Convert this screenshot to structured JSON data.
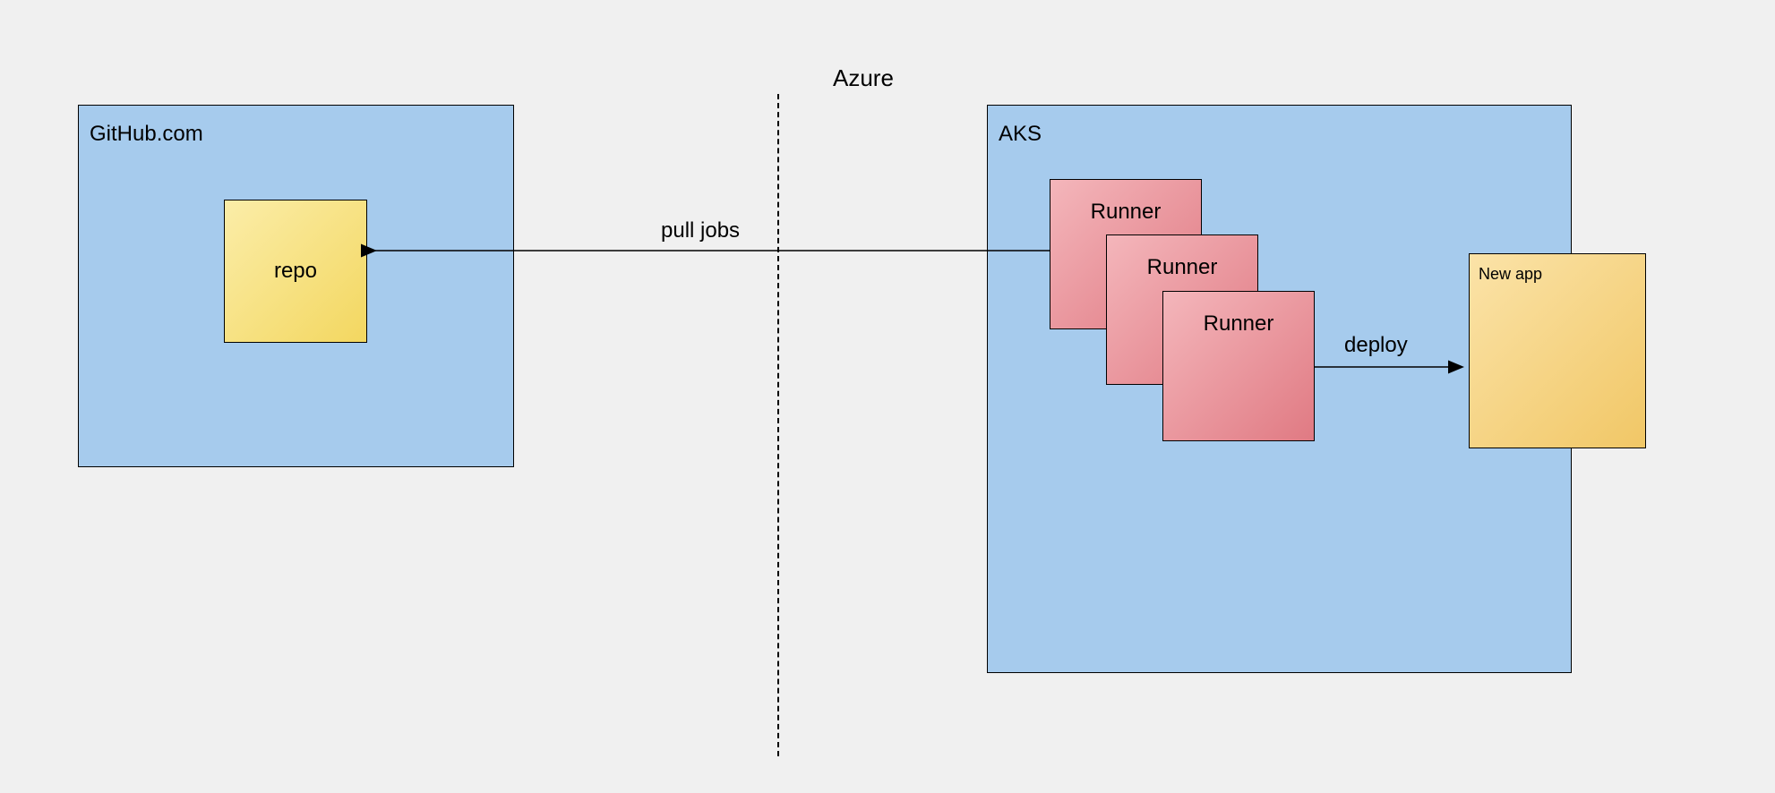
{
  "diagram": {
    "azure_label": "Azure",
    "github": {
      "title": "GitHub.com",
      "repo_label": "repo"
    },
    "aks": {
      "title": "AKS",
      "runners": [
        "Runner",
        "Runner",
        "Runner"
      ],
      "new_app_label": "New app"
    },
    "arrows": {
      "pull_jobs_label": "pull jobs",
      "deploy_label": "deploy"
    }
  },
  "colors": {
    "canvas_bg": "#f0f0f0",
    "container_fill": "#a6cbed",
    "repo_fill_start": "#fbeda8",
    "repo_fill_end": "#f3d760",
    "runner_fill_start": "#f4b6bb",
    "runner_fill_end": "#e07a83",
    "newapp_fill_start": "#fbe3a8",
    "newapp_fill_end": "#f1c766",
    "stroke": "#000000"
  }
}
